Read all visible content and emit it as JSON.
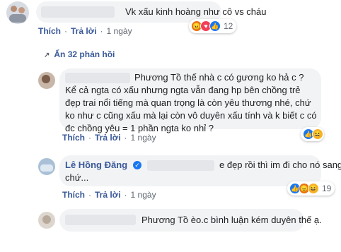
{
  "comment1": {
    "text": "Vk xấu kinh hoàng như cô vs cháu",
    "actions": {
      "like": "Thích",
      "reply": "Trả lời",
      "time": "1 ngày"
    },
    "reactions": {
      "count": "12"
    }
  },
  "hidden_replies": {
    "label": "Ẩn 32 phản hồi"
  },
  "reply1": {
    "text": "Phương Tồ thế nhà c có gương ko hả c ? Kể cả ngta có xấu nhưng ngta vẫn đang hp bên chồng trẻ đẹp trai nổi tiếng mà quan trọng là còn yêu thương nhé, chứ ko như c cũng xấu mà lại còn vô duyên xấu tính và k biết c có đc chồng yêu = 1 phần ngta ko nhỉ ?",
    "actions": {
      "like": "Thích",
      "reply": "Trả lời",
      "time": "1 ngày"
    }
  },
  "reply2": {
    "author": "Lê Hồng Đăng",
    "text_a": "e đẹp rồi thì im đi cho nó sang",
    "text_b": "chứ...",
    "actions": {
      "like": "Thích",
      "reply": "Trả lời",
      "time": "1 ngày"
    },
    "reactions": {
      "count": "19"
    }
  },
  "reply3": {
    "text": "Phương Tồ èo.c bình luận kém duyên thế ạ."
  },
  "colors": {
    "link": "#385898",
    "bubble": "#f2f3f5",
    "like_blue": "#1877f2",
    "haha_yellow": "#f7b125",
    "love_red": "#f33e58",
    "angry_orange": "#e9710f"
  }
}
